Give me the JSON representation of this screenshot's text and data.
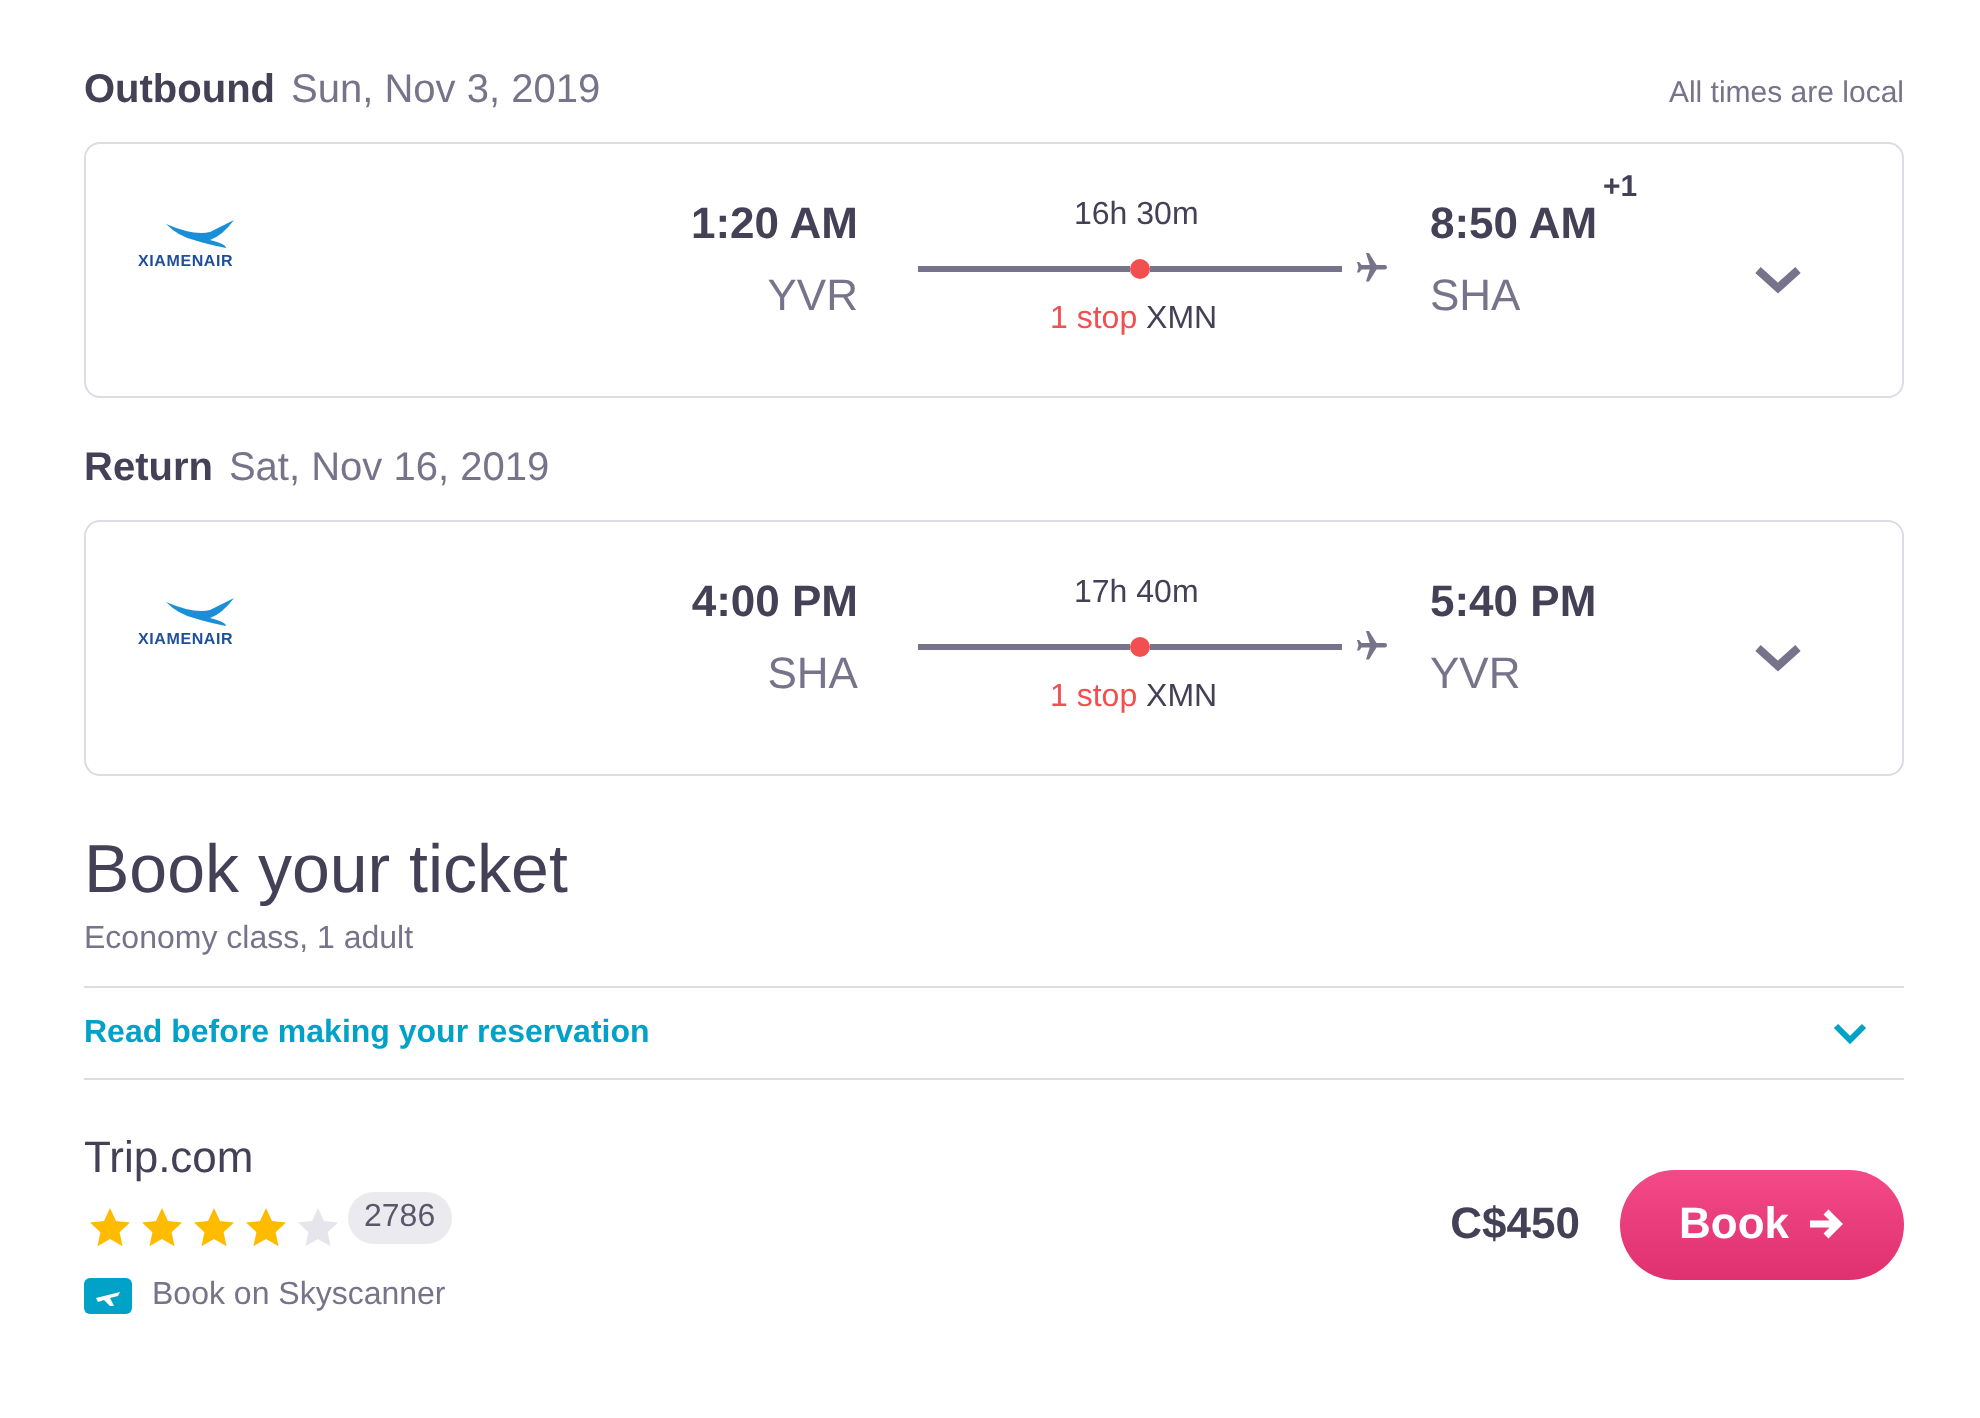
{
  "header_note": "All times are local",
  "legs": [
    {
      "label": "Outbound",
      "date": "Sun, Nov 3, 2019",
      "airline_logo_text": "XIAMENAIR",
      "depart_time": "1:20 AM",
      "depart_airport": "YVR",
      "duration": "16h 30m",
      "stops": "1 stop",
      "stop_airport": "XMN",
      "arrive_time": "8:50 AM",
      "day_offset": "+1",
      "arrive_airport": "SHA",
      "expanded": false
    },
    {
      "label": "Return",
      "date": "Sat, Nov 16, 2019",
      "airline_logo_text": "XIAMENAIR",
      "depart_time": "4:00 PM",
      "depart_airport": "SHA",
      "duration": "17h 40m",
      "stops": "1 stop",
      "stop_airport": "XMN",
      "arrive_time": "5:40 PM",
      "arrive_airport": "YVR",
      "expanded": false
    }
  ],
  "booking": {
    "title": "Book your ticket",
    "subtitle": "Economy class, 1 adult",
    "notice": {
      "label": "Read before making your reservation",
      "expanded": false
    },
    "provider": {
      "name": "Trip.com",
      "stars": 4,
      "reviews": "2786",
      "link": "Book on Skyscanner",
      "price": "C$450",
      "button": "Book"
    }
  }
}
